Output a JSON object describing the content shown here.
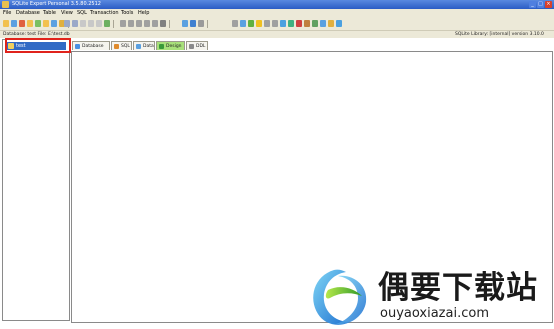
{
  "window": {
    "title": "SQLite Expert Personal 3.5.80.2512",
    "buttons": {
      "min": "_",
      "max": "□",
      "close": "×"
    }
  },
  "menu": [
    "File",
    "Database",
    "Table",
    "View",
    "SQL",
    "Transaction",
    "Tools",
    "Help"
  ],
  "toolbar": {
    "groups": [
      [
        "#f2c14e",
        "#5aa0e0",
        "#e06040",
        "#f2c14e",
        "#7ac060",
        "#f2c14e",
        "#5aa0e0",
        "#e0b040"
      ],
      [
        "#9aa8c8",
        "#9aa8c8",
        "#c8c8c8",
        "#c8c8c8",
        "#c8c8c8",
        "#6cb060"
      ],
      [
        "#a0a0a0",
        "#a0a0a0",
        "#a0a0a0",
        "#a0a0a0",
        "#a0a0a0",
        "#808080"
      ],
      [
        "#5aa0e0",
        "#4080d0",
        "#9a9a9a"
      ],
      [
        "#a0a0a0",
        "#5aa0e0",
        "#60b040",
        "#f0c020",
        "#a0a0a0",
        "#a0a0a0",
        "#4aa0e0",
        "#40b080",
        "#d04040",
        "#c08040",
        "#60a060",
        "#5aa0e0",
        "#e0b040",
        "#4aa0e0"
      ]
    ]
  },
  "infobar": {
    "left": "Database: test   File: E:\\test.db",
    "right": "SQLite Library: [internal] version 3.10.0"
  },
  "tree": {
    "items": [
      {
        "label": "test"
      }
    ]
  },
  "tabs": [
    {
      "label": "Database",
      "color": "#4a90e2",
      "active": false
    },
    {
      "label": "SQL",
      "color": "#e08a2a",
      "active": false
    },
    {
      "label": "Data",
      "color": "#5aa0e0",
      "active": false
    },
    {
      "label": "Design",
      "color": "#3a9a3a",
      "active": true
    },
    {
      "label": "DDL",
      "color": "#8a8a8a",
      "active": false
    }
  ],
  "watermark": {
    "brand_text": "偶要下载站",
    "url": "ouyaoxiazai.com"
  }
}
